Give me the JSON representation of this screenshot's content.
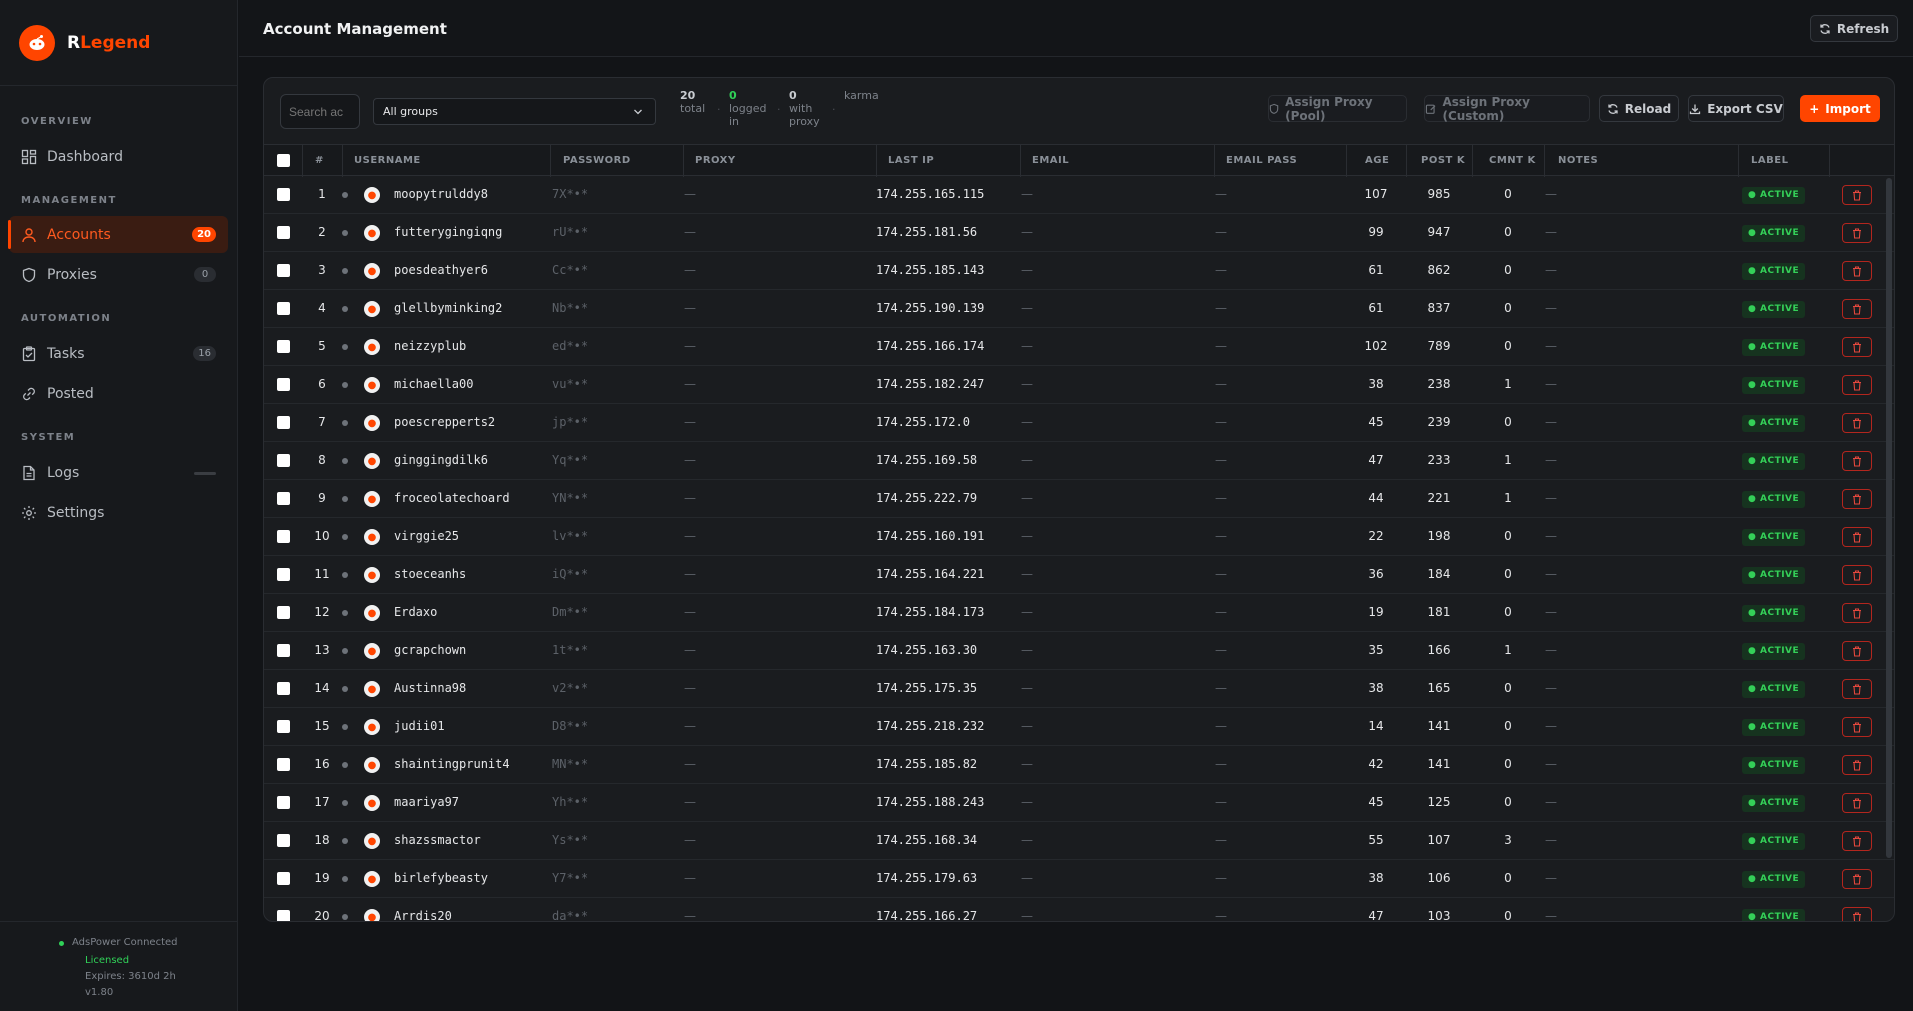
{
  "app": {
    "brand_prefix": "R",
    "brand_rest": "Legend",
    "page_title": "Account Management"
  },
  "colors": {
    "accent": "#ff4500",
    "active_green": "#34d058",
    "background": "#121417"
  },
  "sidebar": {
    "sections": [
      "OVERVIEW",
      "MANAGEMENT",
      "AUTOMATION",
      "SYSTEM"
    ],
    "items": [
      {
        "label": "Dashboard",
        "icon": "dashboard-icon"
      },
      {
        "label": "Accounts",
        "icon": "user-icon",
        "badge": "20",
        "active": true
      },
      {
        "label": "Proxies",
        "icon": "shield-icon",
        "badge": "0"
      },
      {
        "label": "Tasks",
        "icon": "clipboard-icon",
        "badge": "16"
      },
      {
        "label": "Posted",
        "icon": "link-icon"
      },
      {
        "label": "Logs",
        "icon": "file-icon"
      },
      {
        "label": "Settings",
        "icon": "gear-icon"
      }
    ],
    "footer": {
      "connection": "AdsPower Connected",
      "license": "Licensed",
      "expires": "Expires: 3610d 2h",
      "version": "v1.80"
    }
  },
  "header": {
    "refresh_label": "Refresh"
  },
  "toolbar": {
    "search_placeholder": "Search ac",
    "group_selected": "All groups",
    "stats": [
      {
        "value": "20",
        "label": "total"
      },
      {
        "value": "0",
        "label": "logged in"
      },
      {
        "value": "0",
        "label": "with proxy"
      },
      {
        "value": "",
        "label": "karma"
      }
    ],
    "assign_pool_label": "Assign Proxy (Pool)",
    "assign_custom_label": "Assign Proxy (Custom)",
    "reload_label": "Reload",
    "export_label": "Export CSV",
    "import_label": "Import"
  },
  "table": {
    "columns": [
      "#",
      "USERNAME",
      "PASSWORD",
      "PROXY",
      "LAST IP",
      "EMAIL",
      "EMAIL PASS",
      "AGE",
      "POST K",
      "CMNT K",
      "NOTES",
      "LABEL"
    ],
    "empty": "—",
    "rows": [
      {
        "n": "1",
        "username": "moopytrulddy8",
        "password": "7X*•*",
        "ip": "174.255.165.115",
        "age": "107",
        "post": "985",
        "cmnt": "0",
        "label": "ACTIVE"
      },
      {
        "n": "2",
        "username": "futterygingiqng",
        "password": "rU*•*",
        "ip": "174.255.181.56",
        "age": "99",
        "post": "947",
        "cmnt": "0",
        "label": "ACTIVE"
      },
      {
        "n": "3",
        "username": "poesdeathyer6",
        "password": "Cc*•*",
        "ip": "174.255.185.143",
        "age": "61",
        "post": "862",
        "cmnt": "0",
        "label": "ACTIVE"
      },
      {
        "n": "4",
        "username": "glellbyminking2",
        "password": "Nb*•*",
        "ip": "174.255.190.139",
        "age": "61",
        "post": "837",
        "cmnt": "0",
        "label": "ACTIVE"
      },
      {
        "n": "5",
        "username": "neizzyplub",
        "password": "ed*•*",
        "ip": "174.255.166.174",
        "age": "102",
        "post": "789",
        "cmnt": "0",
        "label": "ACTIVE"
      },
      {
        "n": "6",
        "username": "michaella00",
        "password": "vu*•*",
        "ip": "174.255.182.247",
        "age": "38",
        "post": "238",
        "cmnt": "1",
        "label": "ACTIVE"
      },
      {
        "n": "7",
        "username": "poescrepperts2",
        "password": "jp*•*",
        "ip": "174.255.172.0",
        "age": "45",
        "post": "239",
        "cmnt": "0",
        "label": "ACTIVE"
      },
      {
        "n": "8",
        "username": "ginggingdilk6",
        "password": "Yq*•*",
        "ip": "174.255.169.58",
        "age": "47",
        "post": "233",
        "cmnt": "1",
        "label": "ACTIVE"
      },
      {
        "n": "9",
        "username": "froceolatechoard",
        "password": "YN*•*",
        "ip": "174.255.222.79",
        "age": "44",
        "post": "221",
        "cmnt": "1",
        "label": "ACTIVE"
      },
      {
        "n": "10",
        "username": "virggie25",
        "password": "lv*•*",
        "ip": "174.255.160.191",
        "age": "22",
        "post": "198",
        "cmnt": "0",
        "label": "ACTIVE"
      },
      {
        "n": "11",
        "username": "stoeceanhs",
        "password": "iQ*•*",
        "ip": "174.255.164.221",
        "age": "36",
        "post": "184",
        "cmnt": "0",
        "label": "ACTIVE"
      },
      {
        "n": "12",
        "username": "Erdaxo",
        "password": "Dm*•*",
        "ip": "174.255.184.173",
        "age": "19",
        "post": "181",
        "cmnt": "0",
        "label": "ACTIVE"
      },
      {
        "n": "13",
        "username": "gcrapchown",
        "password": "1t*•*",
        "ip": "174.255.163.30",
        "age": "35",
        "post": "166",
        "cmnt": "1",
        "label": "ACTIVE"
      },
      {
        "n": "14",
        "username": "Austinna98",
        "password": "v2*•*",
        "ip": "174.255.175.35",
        "age": "38",
        "post": "165",
        "cmnt": "0",
        "label": "ACTIVE"
      },
      {
        "n": "15",
        "username": "judii01",
        "password": "D8*•*",
        "ip": "174.255.218.232",
        "age": "14",
        "post": "141",
        "cmnt": "0",
        "label": "ACTIVE"
      },
      {
        "n": "16",
        "username": "shaintingprunit4",
        "password": "MN*•*",
        "ip": "174.255.185.82",
        "age": "42",
        "post": "141",
        "cmnt": "0",
        "label": "ACTIVE"
      },
      {
        "n": "17",
        "username": "maariya97",
        "password": "Yh*•*",
        "ip": "174.255.188.243",
        "age": "45",
        "post": "125",
        "cmnt": "0",
        "label": "ACTIVE"
      },
      {
        "n": "18",
        "username": "shazssmactor",
        "password": "Ys*•*",
        "ip": "174.255.168.34",
        "age": "55",
        "post": "107",
        "cmnt": "3",
        "label": "ACTIVE"
      },
      {
        "n": "19",
        "username": "birlefybeasty",
        "password": "Y7*•*",
        "ip": "174.255.179.63",
        "age": "38",
        "post": "106",
        "cmnt": "0",
        "label": "ACTIVE"
      },
      {
        "n": "20",
        "username": "Arrdis20",
        "password": "da*•*",
        "ip": "174.255.166.27",
        "age": "47",
        "post": "103",
        "cmnt": "0",
        "label": "ACTIVE"
      }
    ]
  }
}
